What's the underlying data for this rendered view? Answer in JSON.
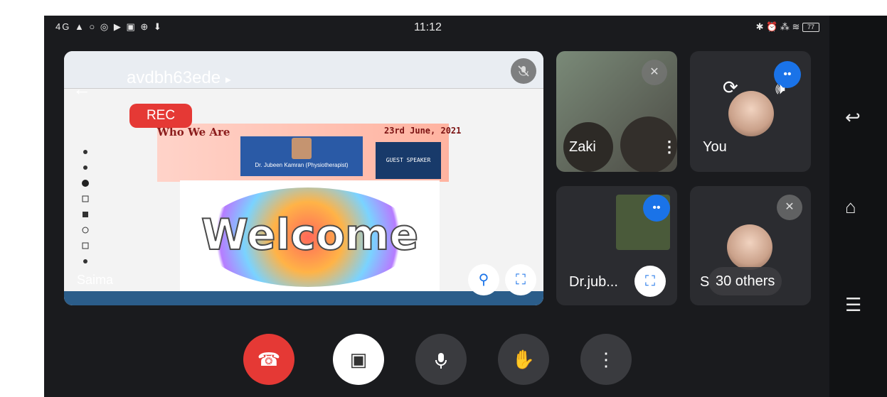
{
  "status_bar": {
    "left_icons": "4G ▲ ○ ◎ ▶ ▣ ⊕ ⬇",
    "time": "11:12",
    "right_icons": "✱ ⏰ ⁂ ≋",
    "battery": "77"
  },
  "main_tile": {
    "meeting_code": "avdbh63ede",
    "meeting_code_arrow": "▸",
    "rec_label": "REC",
    "presenter_name": "Saima",
    "slide": {
      "heading": "Who We Are",
      "date": "23rd June, 2021",
      "speaker_name": "Dr. Jubeen Kamran (Physiotherapist)",
      "guest_badge": "GUEST SPEAKER",
      "welcome": "Welcome"
    }
  },
  "tiles": {
    "zaki": {
      "name": "Zaki"
    },
    "you": {
      "name": "You"
    },
    "drjub": {
      "name": "Dr.jub..."
    },
    "others": {
      "name_prefix": "S",
      "label": "30 others"
    }
  },
  "icons": {
    "back": "back-arrow-icon",
    "mic_off": "mic-off-icon",
    "pin": "pin-icon",
    "fullscreen": "fullscreen-icon",
    "switch_camera": "switch-camera-icon",
    "speaker": "speaker-icon",
    "speaking": "speaking-indicator-icon",
    "more": "more-vert-icon",
    "end_call": "end-call-icon",
    "camera_off": "camera-off-icon",
    "mic": "mic-icon",
    "raise_hand": "raise-hand-icon",
    "nav_back": "nav-back-icon",
    "nav_home": "nav-home-icon",
    "nav_menu": "nav-menu-icon"
  },
  "colors": {
    "end_call": "#e53935",
    "rec": "#e53935",
    "speaking": "#1a73e8",
    "background": "#1a1b1e"
  }
}
